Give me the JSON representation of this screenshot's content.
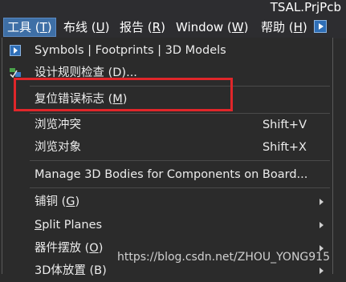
{
  "title": "TSAL.PrjPcb",
  "menubar": {
    "items": [
      {
        "label": "工具 (",
        "mnemonic": "T",
        "suffix": ")"
      },
      {
        "label": "布线 (",
        "mnemonic": "U",
        "suffix": ")"
      },
      {
        "label": "报告 (",
        "mnemonic": "R",
        "suffix": ")"
      },
      {
        "label": "Window (",
        "mnemonic": "W",
        "suffix": ")"
      },
      {
        "label": "帮助 (",
        "mnemonic": "H",
        "suffix": ")"
      }
    ]
  },
  "menu": {
    "symbols": "Symbols | Footprints | 3D Models",
    "drc": "设计规则检查 (D)...",
    "reset_pre": "复位错误标志 (",
    "reset_mn": "M",
    "reset_post": ")",
    "browse_conflicts": "浏览冲突",
    "browse_conflicts_shortcut": "Shift+V",
    "browse_objects": "浏览对象",
    "browse_objects_shortcut": "Shift+X",
    "manage_3d": "Manage 3D Bodies for Components on Board...",
    "copper_pre": "铺铜 (",
    "copper_mn": "G",
    "copper_post": ")",
    "split_mn": "S",
    "split_rest": "plit Planes",
    "placement_pre": "器件摆放 (",
    "placement_mn": "O",
    "placement_post": ")",
    "body3d": "3D体放置 (B)"
  },
  "watermark": "https://blog.csdn.net/ZHOU_YONG915",
  "colors": {
    "accent": "#3e6fa6",
    "highlight": "#e0262a"
  },
  "icons": [
    "play-arrow-icon",
    "drc-check-icon",
    "submenu-arrow-icon"
  ]
}
